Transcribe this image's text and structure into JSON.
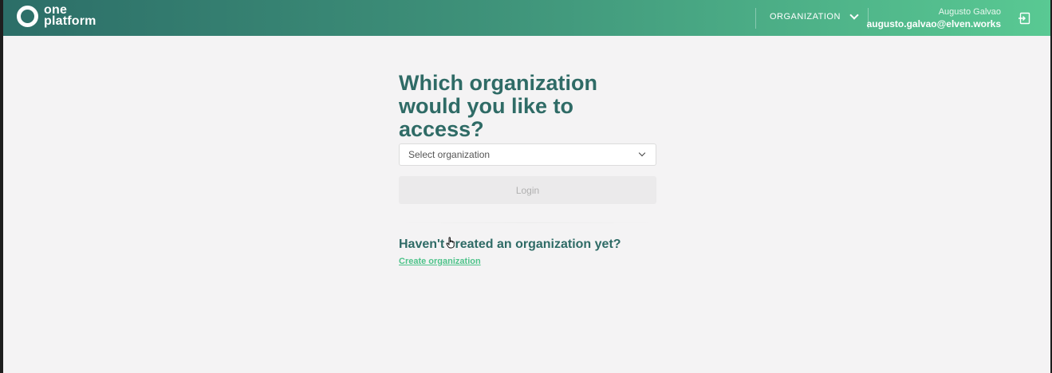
{
  "header": {
    "logo_line1": "one",
    "logo_line2": "platform",
    "org_switch_label": "ORGANIZATION",
    "user_name": "Augusto Galvao",
    "user_email": "augusto.galvao@elven.works",
    "icons": {
      "logo": "circle-logo-icon",
      "org_chevron": "chevron-down-icon",
      "logout": "logout-icon"
    }
  },
  "main": {
    "title_line1": "Which organization",
    "title_line2": "would you like to access?",
    "select_placeholder": "Select organization",
    "login_label": "Login",
    "subtitle": "Haven't created an organization yet?",
    "create_link": "Create organization"
  },
  "colors": {
    "header_gradient_start": "#2c6e68",
    "header_gradient_end": "#59c993",
    "title": "#2f6b66",
    "link": "#4ec38a",
    "background": "#f4f3f4"
  }
}
